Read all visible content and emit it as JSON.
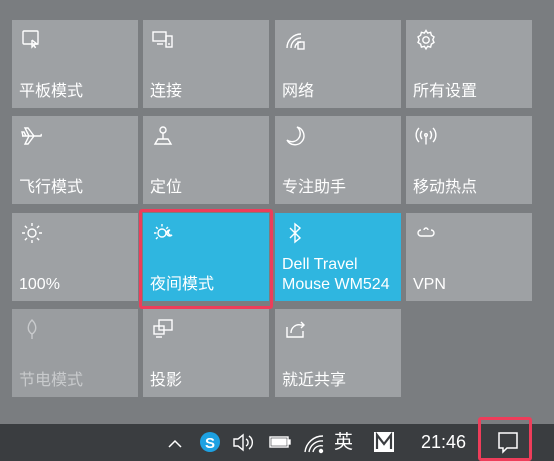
{
  "tiles": [
    {
      "label": "平板模式",
      "icon": "tablet-mode-icon"
    },
    {
      "label": "连接",
      "icon": "connect-icon"
    },
    {
      "label": "网络",
      "icon": "network-icon"
    },
    {
      "label": "所有设置",
      "icon": "settings-icon"
    },
    {
      "label": "飞行模式",
      "icon": "airplane-icon"
    },
    {
      "label": "定位",
      "icon": "location-icon"
    },
    {
      "label": "专注助手",
      "icon": "moon-icon"
    },
    {
      "label": "移动热点",
      "icon": "hotspot-icon"
    },
    {
      "label": "100%",
      "icon": "brightness-icon",
      "level_percent": 100
    },
    {
      "label": "夜间模式",
      "icon": "night-light-icon",
      "state": "on"
    },
    {
      "label": "Dell Travel\nMouse WM524",
      "icon": "bluetooth-icon",
      "state": "on"
    },
    {
      "label": "VPN",
      "icon": "vpn-icon"
    },
    {
      "label": "节电模式",
      "icon": "battery-saver-icon",
      "state": "disabled"
    },
    {
      "label": "投影",
      "icon": "project-icon"
    },
    {
      "label": "就近共享",
      "icon": "nearby-share-icon"
    }
  ],
  "taskbar": {
    "ime_label": "英",
    "clock": "21:46",
    "tray_icons": [
      "chevron-up-icon",
      "skype-icon",
      "volume-icon",
      "battery-icon",
      "wifi-icon",
      "ime-icon",
      "m-app-icon",
      "action-center-icon"
    ]
  },
  "colors": {
    "tile": "#9ea1a4",
    "tile_active": "#2fb6e0",
    "background": "#7a7d80",
    "taskbar": "#3a3d40",
    "highlight": "#ee3d5a"
  }
}
